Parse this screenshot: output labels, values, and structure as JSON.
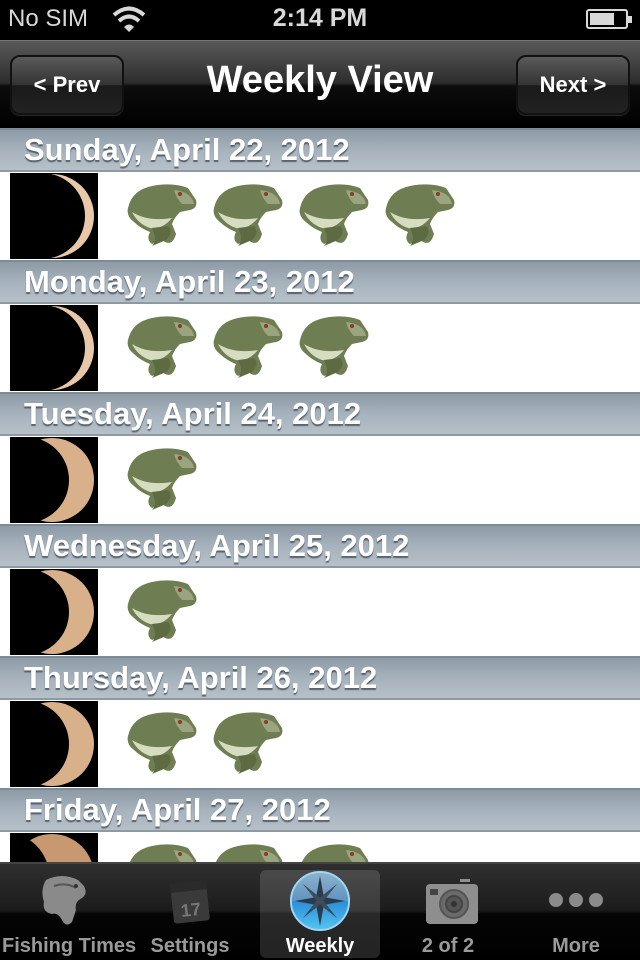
{
  "status_bar": {
    "carrier": "No SIM",
    "time": "2:14 PM",
    "battery_level_fraction": 0.62
  },
  "nav": {
    "title": "Weekly View",
    "prev_label": "< Prev",
    "next_label": "Next >"
  },
  "days": [
    {
      "label": "Sunday, April 22, 2012",
      "moon_phase": "thin-waxing-crescent",
      "fish_count": 4
    },
    {
      "label": "Monday, April 23, 2012",
      "moon_phase": "thin-waxing-crescent",
      "fish_count": 3
    },
    {
      "label": "Tuesday, April 24, 2012",
      "moon_phase": "waxing-crescent",
      "fish_count": 1
    },
    {
      "label": "Wednesday, April 25, 2012",
      "moon_phase": "waxing-crescent",
      "fish_count": 1
    },
    {
      "label": "Thursday, April 26, 2012",
      "moon_phase": "waxing-crescent",
      "fish_count": 2
    },
    {
      "label": "Friday, April 27, 2012",
      "moon_phase": "first-quarter-approaching",
      "fish_count": 3
    }
  ],
  "tabs": [
    {
      "label": "Fishing Times",
      "icon": "fish-icon",
      "active": false
    },
    {
      "label": "Settings",
      "icon": "calendar-icon",
      "active": false
    },
    {
      "label": "Weekly",
      "icon": "compass-icon",
      "active": true
    },
    {
      "label": "2 of 2",
      "icon": "camera-icon",
      "active": false
    },
    {
      "label": "More",
      "icon": "more-icon",
      "active": false
    }
  ],
  "colors": {
    "section_header": "#a6b2bc",
    "tab_active_text": "#ffffff",
    "tab_inactive_text": "#9a9a9a",
    "compass_blue": "#3aa3e0"
  }
}
